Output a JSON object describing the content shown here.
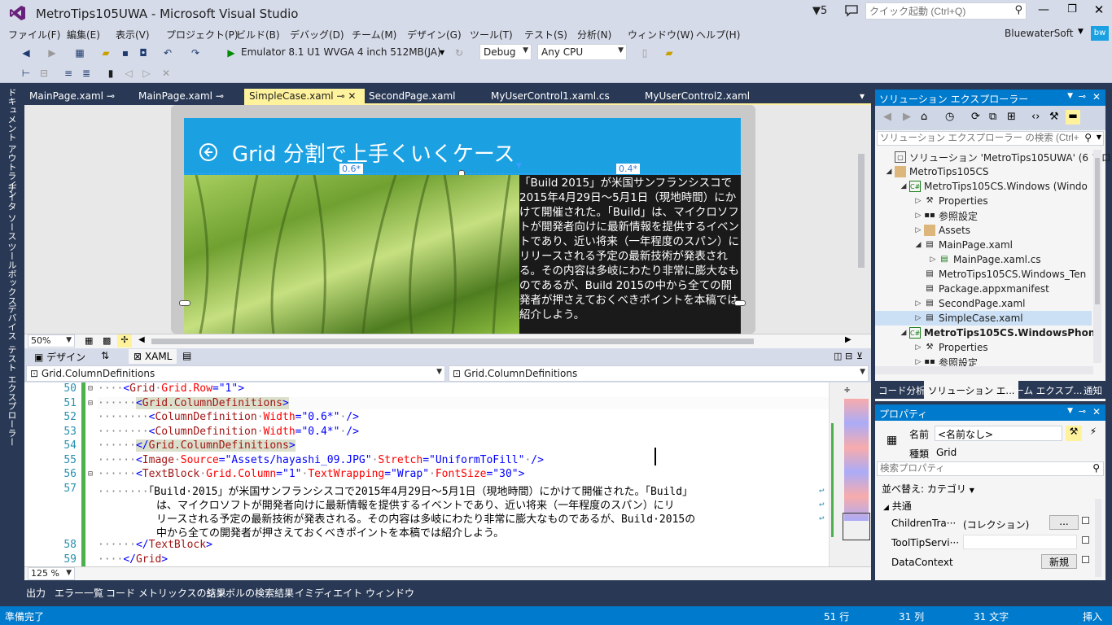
{
  "window": {
    "title": "MetroTips105UWA - Microsoft Visual Studio",
    "notifications": "5",
    "quick_launch_placeholder": "クイック起動 (Ctrl+Q)",
    "account_name": "BluewaterSoft",
    "account_badge": "bw"
  },
  "menu": {
    "items": [
      "ファイル(F)",
      "編集(E)",
      "表示(V)",
      "プロジェクト(P)",
      "ビルド(B)",
      "デバッグ(D)",
      "チーム(M)",
      "デザイン(G)",
      "ツール(T)",
      "テスト(S)",
      "分析(N)",
      "ウィンドウ(W)",
      "ヘルプ(H)"
    ]
  },
  "toolbar": {
    "run_target": "Emulator 8.1 U1 WVGA 4 inch 512MB(JA)",
    "configuration": "Debug",
    "platform": "Any CPU"
  },
  "left_rail": {
    "tabs": [
      "ドキュメント アウトライン",
      "データ ソース",
      "ツールボックス",
      "デバイス",
      "テスト エクスプローラー"
    ]
  },
  "doc_tabs": {
    "tabs": [
      "MainPage.xaml",
      "MainPage.xaml",
      "SimpleCase.xaml",
      "SecondPage.xaml",
      "MyUserControl1.xaml.cs",
      "MyUserControl2.xaml"
    ]
  },
  "designer": {
    "app_title": "Grid 分割で上手くいくケース",
    "col_left_label": "0.6*",
    "col_right_label": "0.4*",
    "textblock": "「Build 2015」が米国サンフランシスコで2015年4月29日～5月1日（現地時間）にかけて開催された。「Build」は、マイクロソフトが開発者向けに最新情報を提供するイベントであり、近い将来（一年程度のスパン）にリリースされる予定の最新技術が発表される。その内容は多岐にわたり非常に膨大なものであるが、Build 2015の中から全ての開発者が押さえておくべきポイントを本稿では紹介しよう。",
    "zoom": "50%"
  },
  "split": {
    "design_tab": "デザイン",
    "xaml_tab": "XAML"
  },
  "nav": {
    "left": "Grid.ColumnDefinitions",
    "right": "Grid.ColumnDefinitions"
  },
  "editor": {
    "zoom": "125 %",
    "lines": [
      {
        "num": "50"
      },
      {
        "num": "51"
      },
      {
        "num": "52"
      },
      {
        "num": "53"
      },
      {
        "num": "54"
      },
      {
        "num": "55"
      },
      {
        "num": "56"
      },
      {
        "num": "57"
      },
      {
        "num": "58"
      },
      {
        "num": "59"
      }
    ],
    "l57": [
      "「Build·2015」が米国サンフランシスコで2015年4月29日～5月1日（現地時間）にかけて開催された。「Build」",
      "は、マイクロソフトが開発者向けに最新情報を提供するイベントであり、近い将来（一年程度のスパン）にリ",
      "リースされる予定の最新技術が発表される。その内容は多岐にわたり非常に膨大なものであるが、Build·2015の",
      "中から全ての開発者が押さえておくべきポイントを本稿では紹介しよう。"
    ]
  },
  "bottom_tabs": [
    "出力",
    "エラー一覧",
    "コード メトリックスの結果",
    "シンボルの検索結果",
    "イミディエイト ウィンドウ"
  ],
  "solution_explorer": {
    "title": "ソリューション エクスプローラー",
    "search_placeholder": "ソリューション エクスプローラー の検索 (Ctrl+;)",
    "items": [
      "ソリューション 'MetroTips105UWA' (6 プロジェ",
      "MetroTips105CS",
      "MetroTips105CS.Windows (Windo",
      "Properties",
      "参照設定",
      "Assets",
      "MainPage.xaml",
      "MainPage.xaml.cs",
      "MetroTips105CS.Windows_Ten",
      "Package.appxmanifest",
      "SecondPage.xaml",
      "SimpleCase.xaml",
      "MetroTips105CS.WindowsPhon",
      "Properties",
      "参照設定"
    ],
    "tabs": [
      "コード分析",
      "ソリューション エ...",
      "チーム エクスプ...",
      "通知"
    ]
  },
  "properties": {
    "title": "プロパティ",
    "name_label": "名前",
    "name_value": "<名前なし>",
    "type_label": "種類",
    "type_value": "Grid",
    "search_placeholder": "検索プロパティ",
    "sort_label": "並べ替え: カテゴリ",
    "category": "共通",
    "rows": [
      {
        "name": "ChildrenTra···",
        "value": "(コレクション)",
        "button": "..."
      },
      {
        "name": "ToolTipServi···",
        "value": "",
        "button": ""
      },
      {
        "name": "DataContext",
        "value": "",
        "button": "新規"
      }
    ]
  },
  "status": {
    "ready": "準備完了",
    "line": "51 行",
    "col": "31 列",
    "ch": "31 文字",
    "mode": "挿入"
  }
}
